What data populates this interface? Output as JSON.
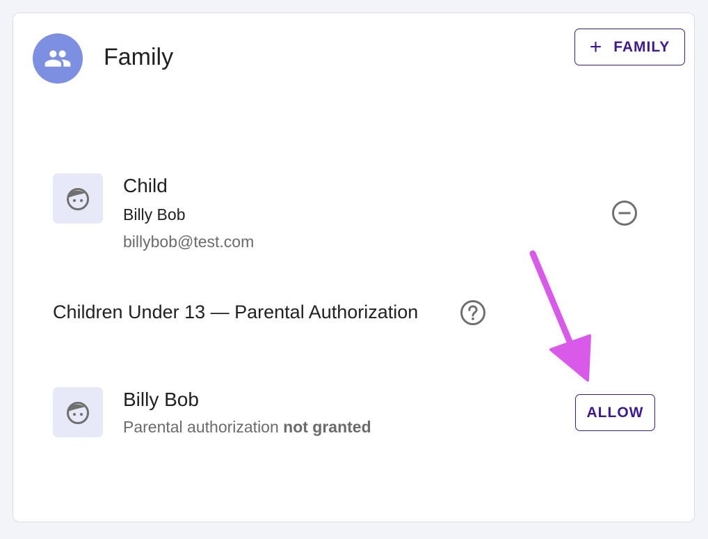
{
  "header": {
    "title": "Family",
    "avatar_icon": "people-group-icon",
    "avatar_color": "#7c8fe0",
    "add_button": {
      "icon": "plus-icon",
      "label": "FAMILY"
    }
  },
  "members": [
    {
      "role": "Child",
      "name": "Billy Bob",
      "email": "billybob@test.com",
      "avatar_icon": "child-face-icon",
      "action_icon": "remove-circle-icon"
    }
  ],
  "parental_auth": {
    "section_title": "Children Under 13 — Parental Authorization",
    "help_icon": "help-circle-icon",
    "items": [
      {
        "name": "Billy Bob",
        "status_prefix": "Parental authorization",
        "status_value": "not granted",
        "avatar_icon": "child-face-icon",
        "action_label": "ALLOW"
      }
    ]
  },
  "annotation": {
    "type": "arrow",
    "color": "#d95ae8"
  },
  "colors": {
    "accent": "#3d1a8e",
    "tile_bg": "#e7e9f8",
    "page_bg": "#f3f4f9"
  }
}
